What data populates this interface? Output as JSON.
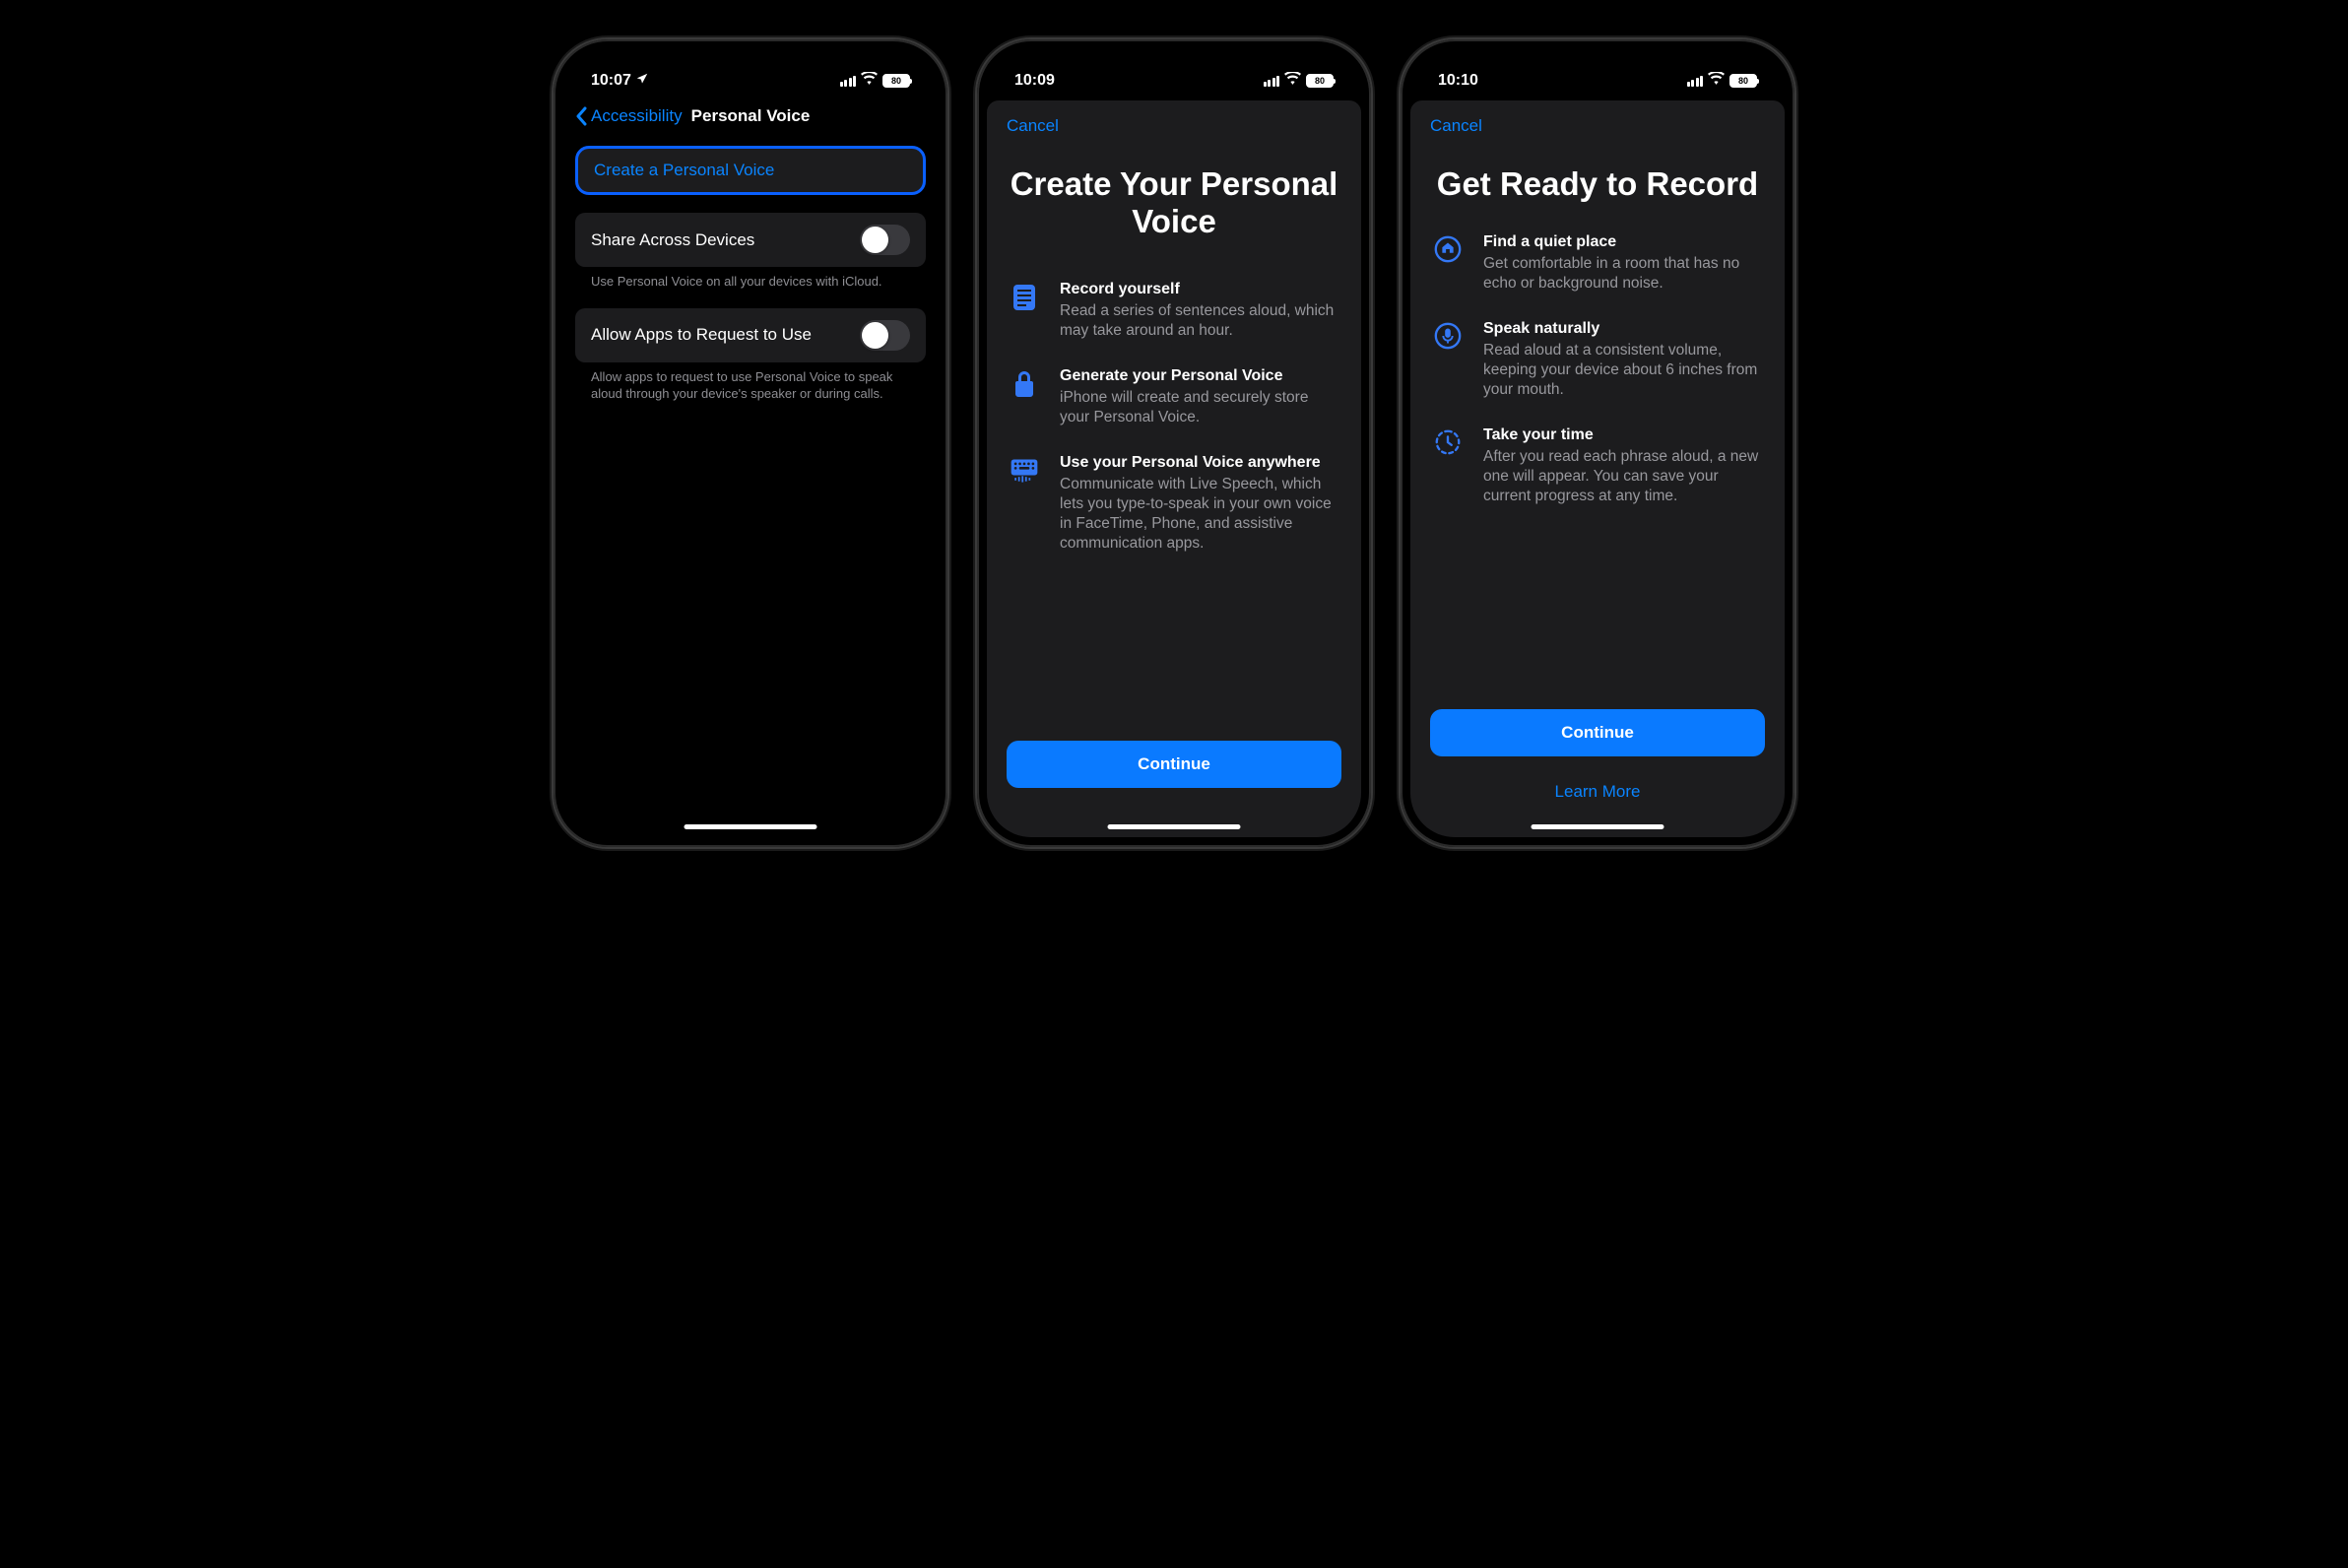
{
  "screen1": {
    "time": "10:07",
    "battery": "80",
    "back_label": "Accessibility",
    "title": "Personal Voice",
    "create_label": "Create a Personal Voice",
    "share_label": "Share Across Devices",
    "share_footer": "Use Personal Voice on all your devices with iCloud.",
    "allow_label": "Allow Apps to Request to Use",
    "allow_footer": "Allow apps to request to use Personal Voice to speak aloud through your device's speaker or during calls."
  },
  "screen2": {
    "time": "10:09",
    "battery": "80",
    "cancel": "Cancel",
    "title": "Create Your Personal Voice",
    "rows": [
      {
        "title": "Record yourself",
        "desc": "Read a series of sentences aloud, which may take around an hour."
      },
      {
        "title": "Generate your Personal Voice",
        "desc": "iPhone will create and securely store your Personal Voice."
      },
      {
        "title": "Use your Personal Voice anywhere",
        "desc": "Communicate with Live Speech, which lets you type-to-speak in your own voice in FaceTime, Phone, and assistive communication apps."
      }
    ],
    "continue": "Continue"
  },
  "screen3": {
    "time": "10:10",
    "battery": "80",
    "cancel": "Cancel",
    "title": "Get Ready to Record",
    "rows": [
      {
        "title": "Find a quiet place",
        "desc": "Get comfortable in a room that has no echo or background noise."
      },
      {
        "title": "Speak naturally",
        "desc": "Read aloud at a consistent volume, keeping your device about 6 inches from your mouth."
      },
      {
        "title": "Take your time",
        "desc": "After you read each phrase aloud, a new one will appear. You can save your current progress at any time."
      }
    ],
    "continue": "Continue",
    "learn_more": "Learn More"
  }
}
